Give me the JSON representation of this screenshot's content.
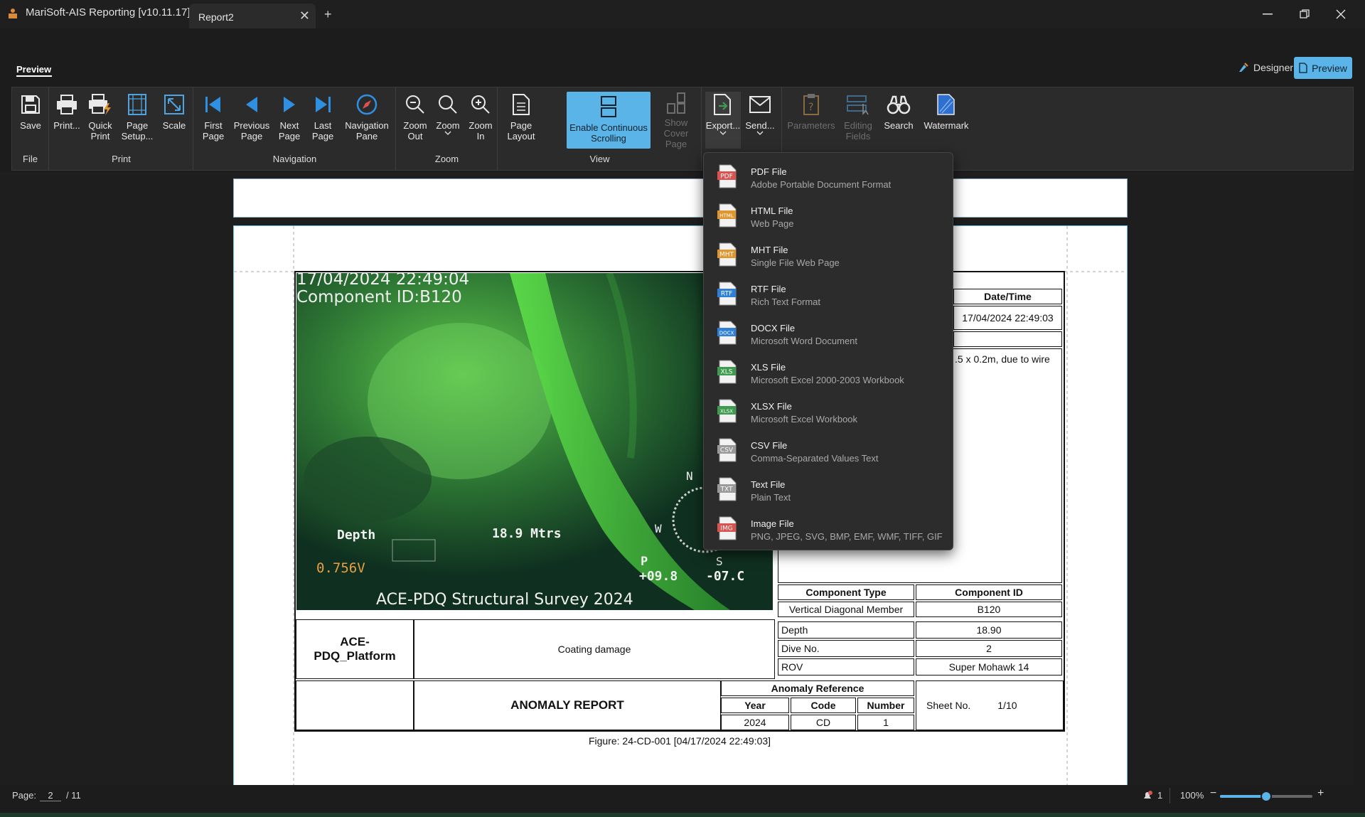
{
  "window": {
    "app_title": "MariSoft-AIS Reporting [v10.11.17]",
    "tab_label": "Report2"
  },
  "ribbon_tab": "Preview",
  "modes": {
    "designer": "Designer",
    "preview": "Preview"
  },
  "groups": {
    "file": {
      "label": "File",
      "save": "Save"
    },
    "print": {
      "label": "Print",
      "print": "Print...",
      "quick_print": [
        "Quick",
        "Print"
      ],
      "page_setup": [
        "Page",
        "Setup..."
      ],
      "scale": "Scale"
    },
    "navigation": {
      "label": "Navigation",
      "first": [
        "First",
        "Page"
      ],
      "previous": [
        "Previous",
        "Page"
      ],
      "next": [
        "Next",
        "Page"
      ],
      "last": [
        "Last",
        "Page"
      ],
      "pane": [
        "Navigation",
        "Pane"
      ]
    },
    "zoom": {
      "label": "Zoom",
      "zoom_out": [
        "Zoom",
        "Out"
      ],
      "zoom": "Zoom",
      "zoom_in": [
        "Zoom",
        "In"
      ]
    },
    "view": {
      "label": "View",
      "page_layout": [
        "Page",
        "Layout"
      ],
      "continuous": [
        "Enable Continuous",
        "Scrolling"
      ],
      "cover": [
        "Show Cover",
        "Page"
      ]
    },
    "other": {
      "export": "Export...",
      "send": "Send...",
      "parameters": "Parameters",
      "editing_fields": [
        "Editing",
        "Fields"
      ],
      "search": "Search",
      "watermark": "Watermark"
    }
  },
  "export_menu": [
    {
      "icon": "pdf-icon",
      "badge": "PDF",
      "color": "#d9534f",
      "title": "PDF File",
      "desc": "Adobe Portable Document Format"
    },
    {
      "icon": "html-icon",
      "badge": "HTML",
      "color": "#e0962f",
      "title": "HTML File",
      "desc": "Web Page"
    },
    {
      "icon": "mht-icon",
      "badge": "MHT",
      "color": "#e0962f",
      "title": "MHT File",
      "desc": "Single File Web Page"
    },
    {
      "icon": "rtf-icon",
      "badge": "RTF",
      "color": "#2f7fd6",
      "title": "RTF File",
      "desc": "Rich Text Format"
    },
    {
      "icon": "docx-icon",
      "badge": "DOCX",
      "color": "#2f7fd6",
      "title": "DOCX File",
      "desc": "Microsoft Word Document"
    },
    {
      "icon": "xls-icon",
      "badge": "XLS",
      "color": "#3f9b4f",
      "title": "XLS File",
      "desc": "Microsoft Excel 2000-2003 Workbook"
    },
    {
      "icon": "xlsx-icon",
      "badge": "XLSX",
      "color": "#3f9b4f",
      "title": "XLSX File",
      "desc": "Microsoft Excel Workbook"
    },
    {
      "icon": "csv-icon",
      "badge": "CSV",
      "color": "#9a9a9a",
      "title": "CSV File",
      "desc": "Comma-Separated Values Text"
    },
    {
      "icon": "txt-icon",
      "badge": "TXT",
      "color": "#9a9a9a",
      "title": "Text File",
      "desc": "Plain Text"
    },
    {
      "icon": "img-icon",
      "badge": "IMG",
      "color": "#d9534f",
      "title": "Image File",
      "desc": "PNG, JPEG, SVG, BMP, EMF, WMF, TIFF, GIF"
    }
  ],
  "report": {
    "osd": {
      "timestamp": "17/04/2024 22:49:04",
      "component": "Component ID:B120",
      "depth_label": "Depth",
      "depth_value": "18.9 Mtrs",
      "voltage": "0.756V",
      "compass_n": "N",
      "compass_w": "W",
      "compass_s": "S",
      "p_label": "P",
      "p_value": "+09.8",
      "r_value": "-07.C",
      "survey_title": "ACE-PDQ Structural Survey 2024"
    },
    "datetime_header": "Date/Time",
    "datetime_value": "17/04/2024 22:49:03",
    "description_fragment": ".5 x 0.2m, due to wire",
    "component_type_header": "Component Type",
    "component_id_header": "Component ID",
    "component_type": "Vertical Diagonal Member",
    "component_id": "B120",
    "depth_label": "Depth",
    "depth_value": "18.90",
    "dive_label": "Dive No.",
    "dive_value": "2",
    "rov_label": "ROV",
    "rov_value": "Super Mohawk 14",
    "platform": [
      "ACE-",
      "PDQ_Platform"
    ],
    "anomaly_desc": "Coating damage",
    "report_title": "ANOMALY REPORT",
    "anomaly_ref_header": "Anomaly Reference",
    "year_header": "Year",
    "code_header": "Code",
    "number_header": "Number",
    "year": "2024",
    "code": "CD",
    "number": "1",
    "sheet_label": "Sheet No.",
    "sheet_value": "1/10",
    "figure_caption": "Figure: 24-CD-001 [04/17/2024 22:49:03]"
  },
  "status": {
    "page_label": "Page:",
    "page_current": "2",
    "page_total": "/ 11",
    "notifications": "1",
    "zoom": "100%",
    "zoom_level": 0.5
  }
}
